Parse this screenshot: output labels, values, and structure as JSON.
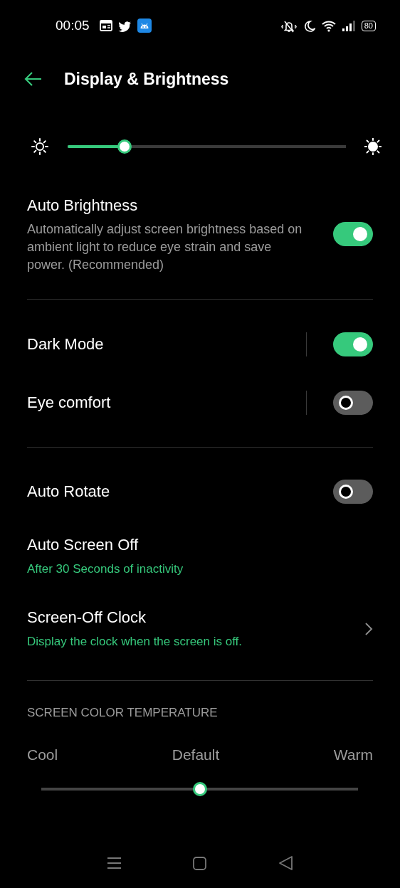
{
  "status_bar": {
    "time": "00:05",
    "battery": "80"
  },
  "header": {
    "title": "Display & Brightness"
  },
  "brightness": {
    "level": 0.205
  },
  "groups": [
    {
      "items": [
        {
          "kind": "toggle",
          "title": "Auto Brightness",
          "description": "Automatically adjust screen brightness based on ambient light to reduce eye strain and save power. (Recommended)",
          "on": true,
          "separator": false
        }
      ]
    },
    {
      "items": [
        {
          "kind": "toggle",
          "title": "Dark Mode",
          "on": true,
          "separator": true
        },
        {
          "kind": "toggle",
          "title": "Eye comfort",
          "on": false,
          "separator": true
        }
      ]
    },
    {
      "items": [
        {
          "kind": "toggle",
          "title": "Auto Rotate",
          "on": false,
          "separator": false
        },
        {
          "kind": "value",
          "title": "Auto Screen Off",
          "subtitle": "After 30 Seconds of inactivity"
        },
        {
          "kind": "link",
          "title": "Screen-Off Clock",
          "subtitle": "Display the clock when the screen is off."
        }
      ]
    }
  ],
  "color_temperature": {
    "heading": "SCREEN COLOR TEMPERATURE",
    "labels": [
      "Cool",
      "Default",
      "Warm"
    ],
    "level": 0.5
  }
}
